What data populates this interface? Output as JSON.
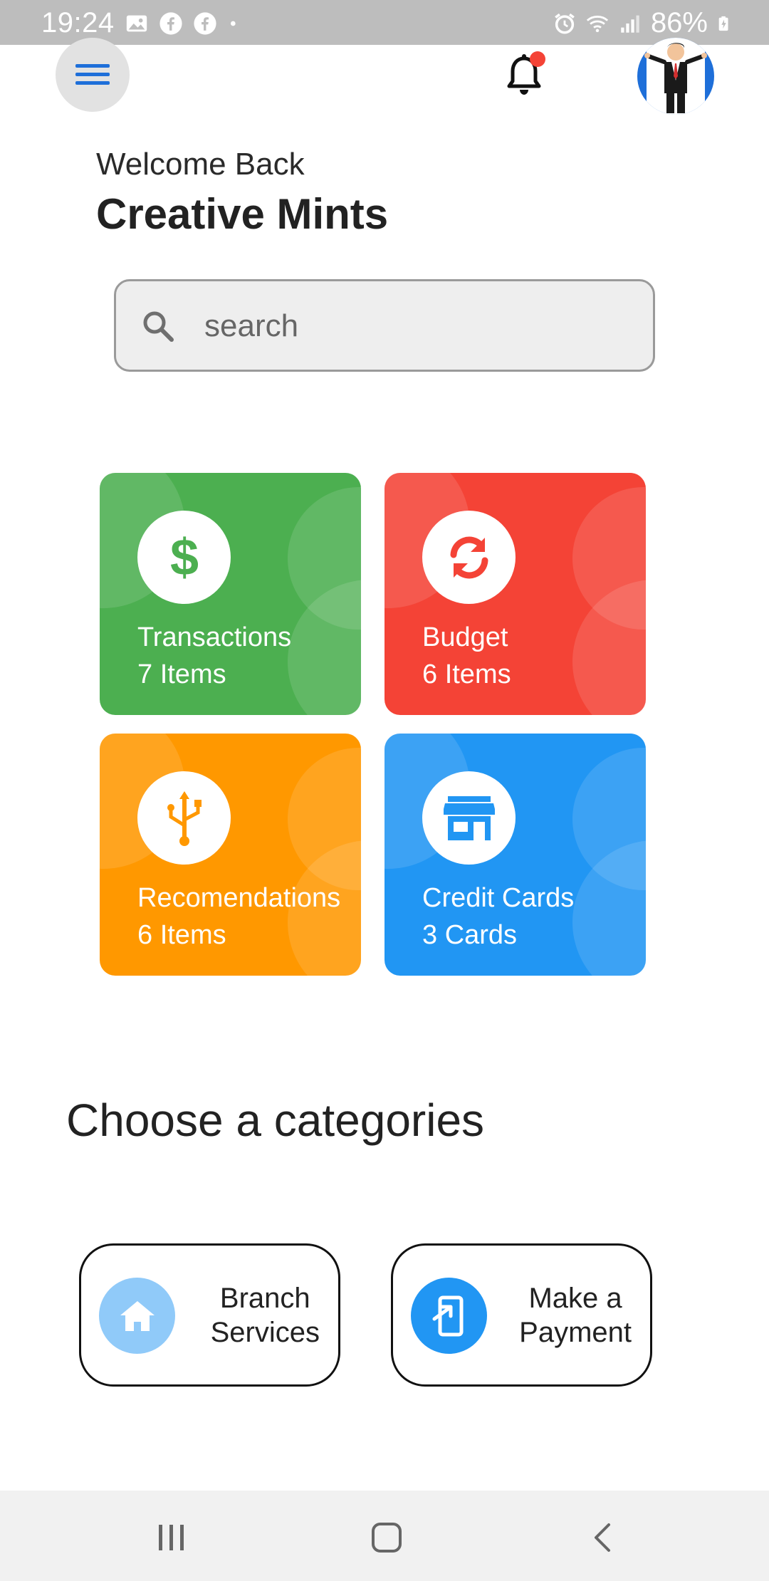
{
  "status_bar": {
    "time": "19:24",
    "battery": "86%",
    "icons": [
      "gallery-icon",
      "facebook-icon",
      "facebook-icon",
      "dot-icon",
      "alarm-icon",
      "wifi-icon",
      "signal-icon",
      "battery-charging-icon"
    ]
  },
  "header": {
    "menu_icon": "hamburger-menu-icon",
    "notification_icon": "bell-icon",
    "notification_badge_color": "#f44336",
    "avatar": "user-avatar"
  },
  "greeting": {
    "welcome": "Welcome Back",
    "name": "Creative Mints"
  },
  "search": {
    "placeholder": "search",
    "value": ""
  },
  "cards": [
    {
      "title": "Transactions",
      "subtitle": "7 Items",
      "icon": "dollar-icon",
      "color": "#4caf50"
    },
    {
      "title": "Budget",
      "subtitle": "6 Items",
      "icon": "refresh-icon",
      "color": "#f44336"
    },
    {
      "title": "Recomendations",
      "subtitle": "6 Items",
      "icon": "usb-icon",
      "color": "#ff9800"
    },
    {
      "title": "Credit Cards",
      "subtitle": "3 Cards",
      "icon": "store-icon",
      "color": "#2196f3"
    }
  ],
  "categories": {
    "heading": "Choose a categories",
    "items": [
      {
        "line1": "Branch",
        "line2": "Services",
        "icon": "home-icon",
        "icon_bg": "#90caf9"
      },
      {
        "line1": "Make a",
        "line2": "Payment",
        "icon": "payment-icon",
        "icon_bg": "#2196f3"
      }
    ]
  },
  "nav_bar": {
    "buttons": [
      "recents-icon",
      "home-nav-icon",
      "back-icon"
    ]
  }
}
